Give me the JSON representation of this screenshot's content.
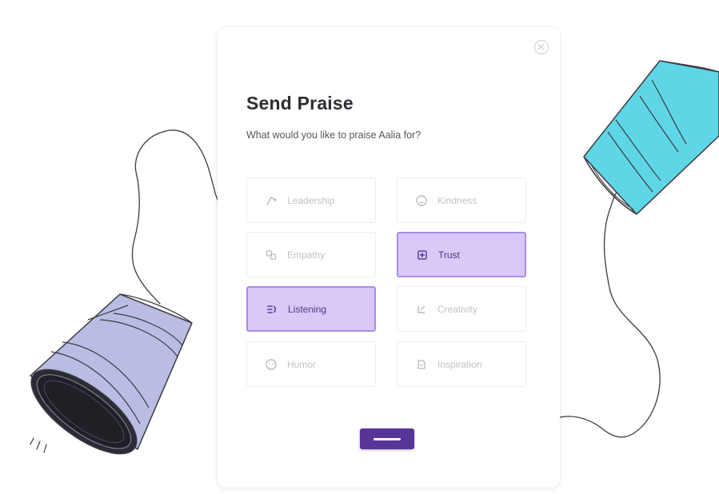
{
  "dialog": {
    "title": "Send Praise",
    "subtitle": "What would you like to praise Aalia for?",
    "options": [
      {
        "label": "Leadership",
        "icon": "leadership-icon",
        "selected": false
      },
      {
        "label": "Kindness",
        "icon": "kindness-icon",
        "selected": false
      },
      {
        "label": "Empathy",
        "icon": "empathy-icon",
        "selected": false
      },
      {
        "label": "Trust",
        "icon": "trust-icon",
        "selected": true
      },
      {
        "label": "Listening",
        "icon": "listening-icon",
        "selected": true
      },
      {
        "label": "Creativity",
        "icon": "creativity-icon",
        "selected": false
      },
      {
        "label": "Humor",
        "icon": "humor-icon",
        "selected": false
      },
      {
        "label": "Inspiration",
        "icon": "inspiration-icon",
        "selected": false
      }
    ]
  },
  "colors": {
    "accent": "#563596",
    "selected_fill": "#d9c9f6",
    "selected_border": "#a98be6",
    "cup_left": "#b9bde4",
    "cup_right": "#5fd6e6"
  }
}
